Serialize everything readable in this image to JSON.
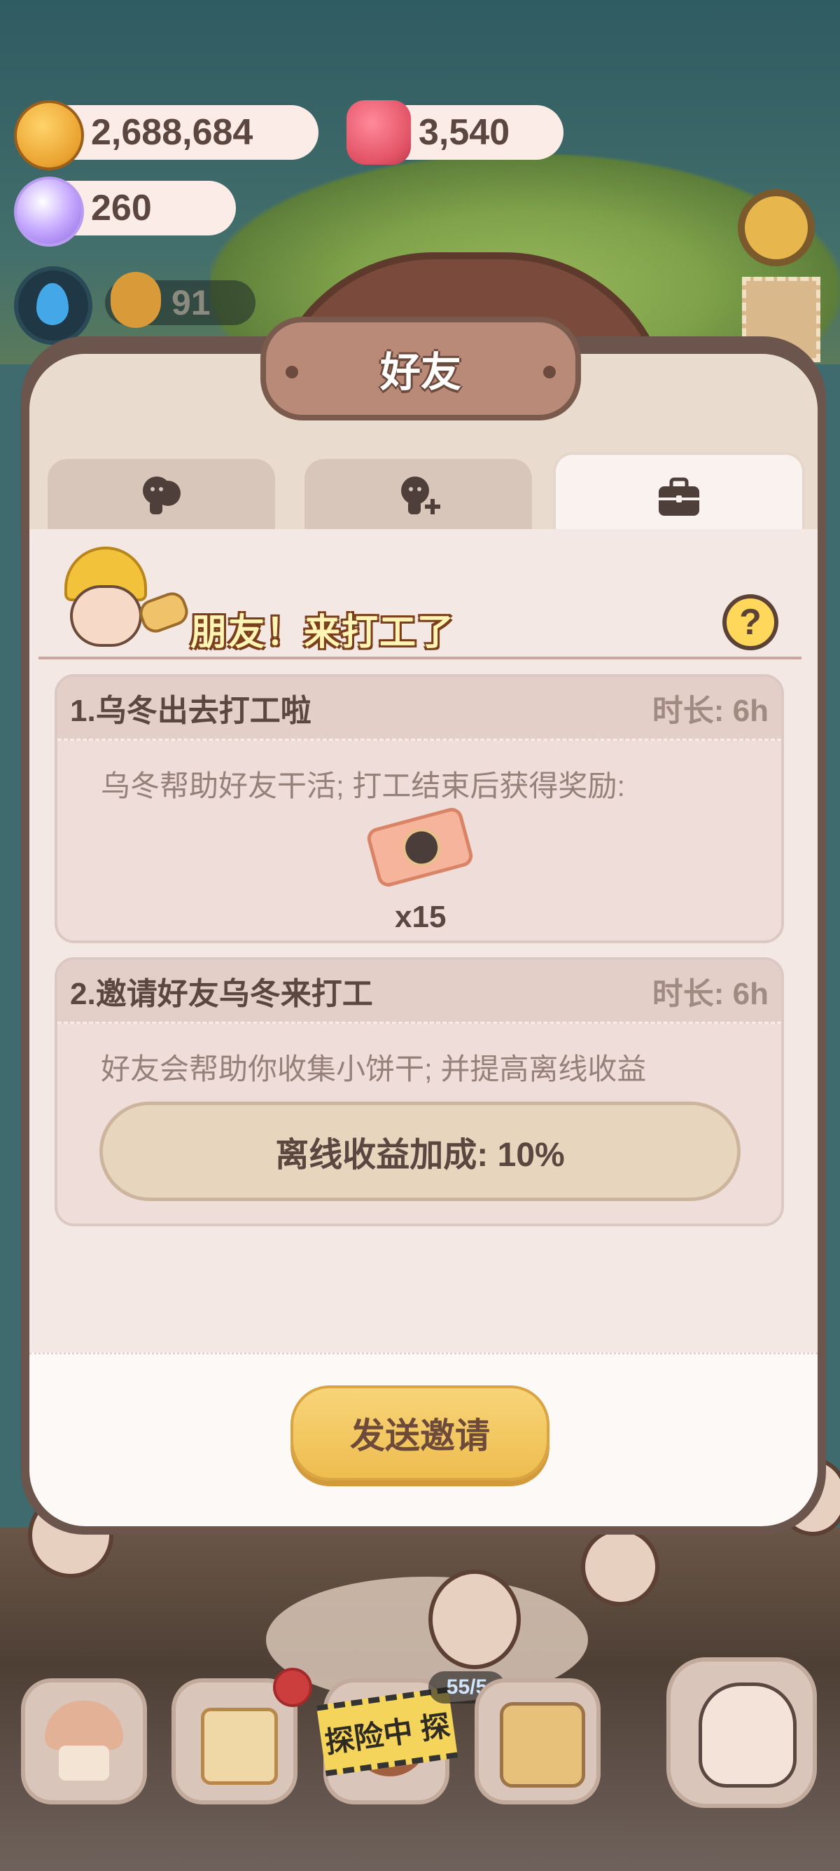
{
  "currencies": {
    "cookies": "2,688,684",
    "candles": "3,540",
    "gems": "260",
    "workers": "91"
  },
  "dialog": {
    "title": "好友",
    "tabs": [
      {
        "name": "friends",
        "icon": "friends-icon",
        "active": false
      },
      {
        "name": "add-friend",
        "icon": "add-friend-icon",
        "active": false
      },
      {
        "name": "work",
        "icon": "briefcase-icon",
        "active": true
      }
    ],
    "banner_title": "朋友！来打工了",
    "help_label": "?",
    "cards": [
      {
        "title": "1.乌冬出去打工啦",
        "duration": "时长: 6h",
        "description": "乌冬帮助好友干活; 打工结束后获得奖励:",
        "reward": {
          "icon": "ticket-icon",
          "quantity": "x15"
        }
      },
      {
        "title": "2.邀请好友乌冬来打工",
        "duration": "时长: 6h",
        "description": "好友会帮助你收集小饼干; 并提高离线收益",
        "bonus": "离线收益加成: 10%"
      }
    ],
    "send_button": "发送邀请"
  },
  "bottom_nav": {
    "explore_label": "探险中 探",
    "status": "55/5"
  },
  "colors": {
    "dialog_border": "#6b554c",
    "panel": "#efe3da",
    "button_gold": "#f8d478",
    "text_brown": "#5b4640"
  }
}
